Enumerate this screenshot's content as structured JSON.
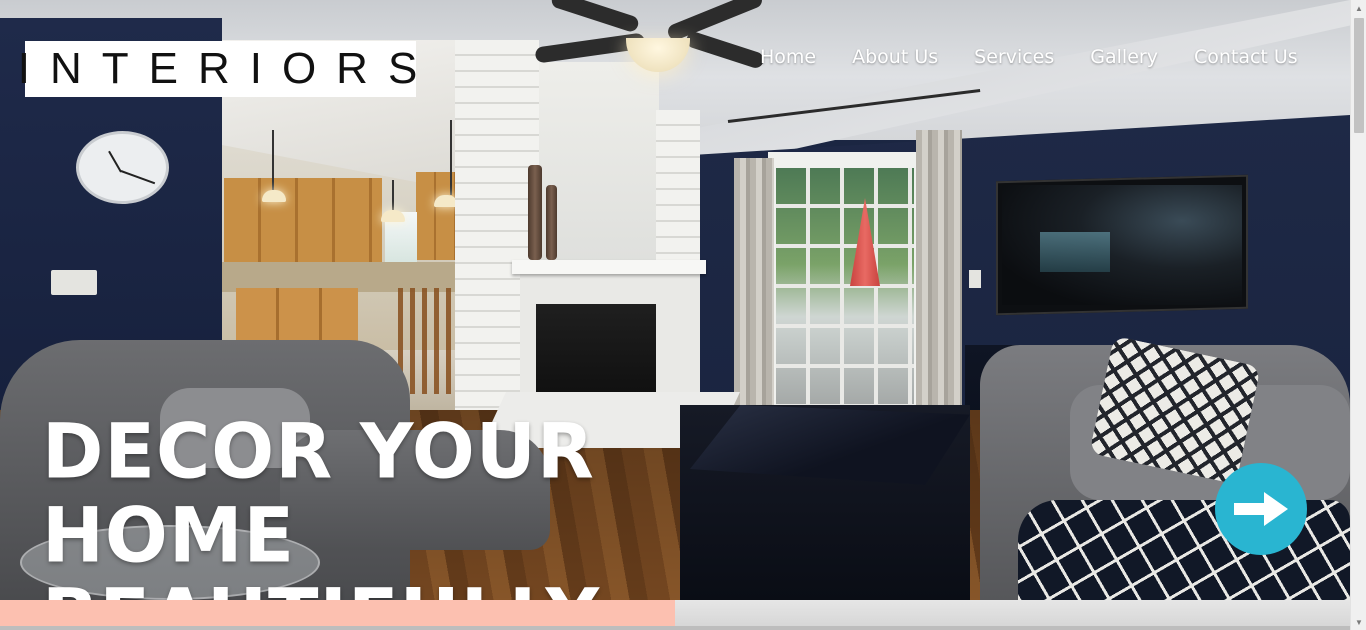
{
  "site": {
    "logo_text": "INTERIORS"
  },
  "nav": {
    "items": [
      {
        "label": "Home"
      },
      {
        "label": "About Us"
      },
      {
        "label": "Services"
      },
      {
        "label": "Gallery"
      },
      {
        "label": "Contact Us"
      }
    ]
  },
  "hero": {
    "headline_line1": "DECOR YOUR HOME",
    "headline_line2": "BEAUTIFULLY",
    "next_icon": "arrow-right-icon"
  },
  "colors": {
    "accent": "#29b5d1",
    "bottom_bar": "#fcc0b0",
    "text_light": "#ffffff",
    "logo_bg": "#ffffff",
    "logo_text": "#111111"
  }
}
